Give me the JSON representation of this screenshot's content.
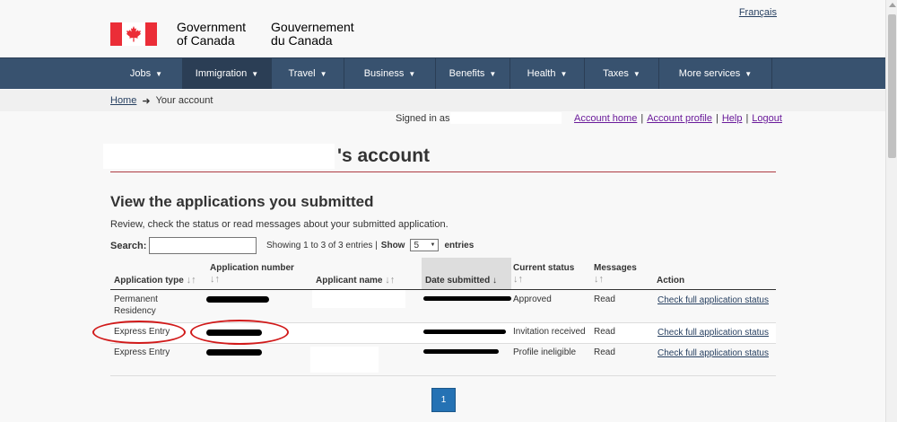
{
  "header": {
    "language_link": "Français",
    "wordmark_en_1": "Government",
    "wordmark_en_2": "of Canada",
    "wordmark_fr_1": "Gouvernement",
    "wordmark_fr_2": "du Canada"
  },
  "nav": {
    "items": [
      {
        "label": "Jobs"
      },
      {
        "label": "Immigration"
      },
      {
        "label": "Travel"
      },
      {
        "label": "Business"
      },
      {
        "label": "Benefits"
      },
      {
        "label": "Health"
      },
      {
        "label": "Taxes"
      },
      {
        "label": "More services"
      }
    ],
    "chevron": "▼"
  },
  "breadcrumb": {
    "home": "Home",
    "arrow": "➜",
    "current": "Your account"
  },
  "account_bar": {
    "signed_in_as": "Signed in as",
    "links": [
      "Account home",
      "Account profile",
      "Help",
      "Logout"
    ],
    "separator": "|"
  },
  "page": {
    "title_suffix": "'s account",
    "section_heading": "View the applications you submitted",
    "description": "Review, check the status or read messages about your submitted application."
  },
  "table_controls": {
    "search_label": "Search:",
    "showing_text": "Showing 1 to 3 of 3 entries |",
    "show_label": "Show",
    "show_value": "5",
    "entries_label": "entries"
  },
  "table": {
    "headers": {
      "type": "Application type",
      "number": "Application number",
      "name": "Applicant name",
      "date": "Date submitted",
      "status": "Current status",
      "messages": "Messages",
      "action": "Action"
    },
    "sort_icon": "↓↑",
    "sort_active_icon": "🡣",
    "rows": [
      {
        "type_1": "Permanent",
        "type_2": "Residency",
        "status": "Approved",
        "messages": "Read",
        "action": "Check full application status"
      },
      {
        "type_1": "Express Entry",
        "type_2": "",
        "status": "Invitation received",
        "messages": "Read",
        "action": "Check full application status"
      },
      {
        "type_1": "Express Entry",
        "type_2": "",
        "status": "Profile ineligible",
        "messages": "Read",
        "action": "Check full application status"
      }
    ]
  },
  "pagination": {
    "current_page": "1"
  },
  "colors": {
    "nav_bg": "#38526f",
    "rule_red": "#af3c43",
    "annotation_red": "#d11a1a",
    "pager_blue": "#2572b4"
  }
}
